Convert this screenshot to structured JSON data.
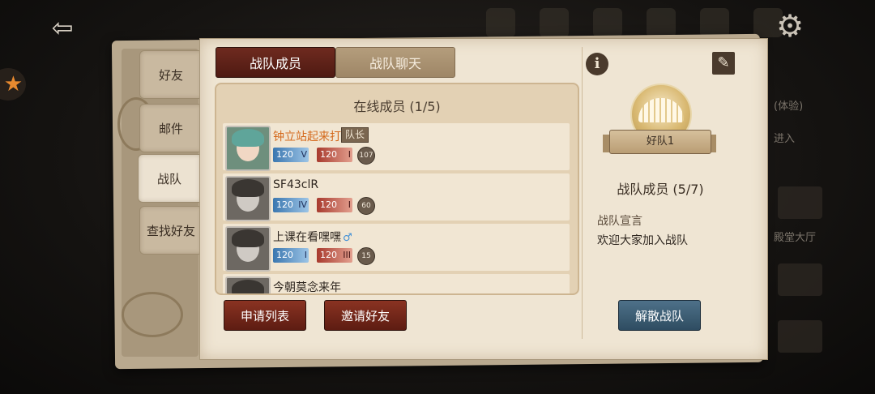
{
  "tabs": {
    "friends": "好友",
    "mail": "邮件",
    "team": "战队",
    "find_friends": "查找好友"
  },
  "header_tabs": {
    "members": "战队成员",
    "chat": "战队聊天"
  },
  "online_title": "在线成员 (1/5)",
  "members": [
    {
      "name": "钟立站起来打",
      "tag": "队长",
      "blue_level": "120",
      "red_level": "120",
      "level": "107",
      "gender": ""
    },
    {
      "name": "SF43clR",
      "tag": "",
      "blue_level": "120",
      "red_level": "120",
      "level": "60",
      "gender": ""
    },
    {
      "name": "上课在看嘿嘿",
      "tag": "",
      "blue_level": "120",
      "red_level": "120",
      "level": "15",
      "gender": "♂"
    },
    {
      "name": "今朝莫念来年",
      "tag": "",
      "blue_level": "",
      "red_level": "",
      "level": "",
      "gender": ""
    }
  ],
  "buttons": {
    "apply_list": "申请列表",
    "invite_friends": "邀请好友",
    "disband": "解散战队"
  },
  "team": {
    "name": "好队1",
    "member_count": "战队成员 (5/7)",
    "declaration_label": "战队宣言",
    "declaration": "欢迎大家加入战队"
  },
  "background_text": {
    "enter": "进入",
    "hall": "殿堂大厅",
    "exp": "(体验)"
  },
  "icons": {
    "exit": "exit-door-icon",
    "settings": "gear-icon",
    "info": "info-icon",
    "edit": "wrench-icon",
    "event": "star-icon"
  }
}
